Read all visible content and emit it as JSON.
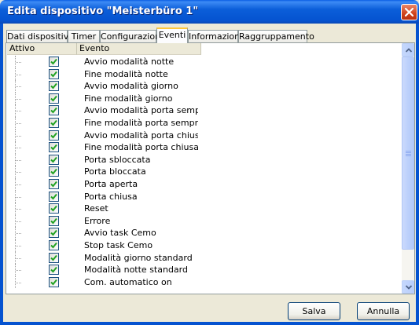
{
  "window": {
    "title": "Edita dispositivo \"Meisterbüro 1\""
  },
  "tabs": [
    {
      "label": "Dati dispositivi",
      "active": false
    },
    {
      "label": "Timer",
      "active": false
    },
    {
      "label": "Configurazione",
      "active": false
    },
    {
      "label": "Eventi",
      "active": true
    },
    {
      "label": "Informazioni",
      "active": false
    },
    {
      "label": "Raggruppamento",
      "active": false
    }
  ],
  "table": {
    "columns": [
      "Attivo",
      "Evento"
    ],
    "rows": [
      {
        "checked": true,
        "event": "Avvio modalità notte"
      },
      {
        "checked": true,
        "event": "Fine modalità notte"
      },
      {
        "checked": true,
        "event": "Avvio modalità giorno"
      },
      {
        "checked": true,
        "event": "Fine modalità giorno"
      },
      {
        "checked": true,
        "event": "Avvio modalità porta sempre ape"
      },
      {
        "checked": true,
        "event": "Fine modalità porta sempre apert"
      },
      {
        "checked": true,
        "event": "Avvio modalità porta chiusa"
      },
      {
        "checked": true,
        "event": "Fine modalità porta chiusa"
      },
      {
        "checked": true,
        "event": "Porta sbloccata"
      },
      {
        "checked": true,
        "event": "Porta bloccata"
      },
      {
        "checked": true,
        "event": "Porta aperta"
      },
      {
        "checked": true,
        "event": "Porta chiusa"
      },
      {
        "checked": true,
        "event": "Reset"
      },
      {
        "checked": true,
        "event": "Errore"
      },
      {
        "checked": true,
        "event": "Avvio task Cemo"
      },
      {
        "checked": true,
        "event": "Stop task Cemo"
      },
      {
        "checked": true,
        "event": "Modalità giorno standard"
      },
      {
        "checked": true,
        "event": "Modalità notte standard"
      },
      {
        "checked": true,
        "event": "Com. automatico on"
      }
    ]
  },
  "buttons": {
    "save_label": "Salva",
    "cancel_label": "Annulla"
  },
  "colors": {
    "titlebar": "#0553d0",
    "checkmark": "#21a121",
    "close_button": "#d0431c"
  },
  "icons": [
    "close-icon",
    "checkbox-icon",
    "scroll-up-arrow-icon",
    "scroll-down-arrow-icon"
  ]
}
